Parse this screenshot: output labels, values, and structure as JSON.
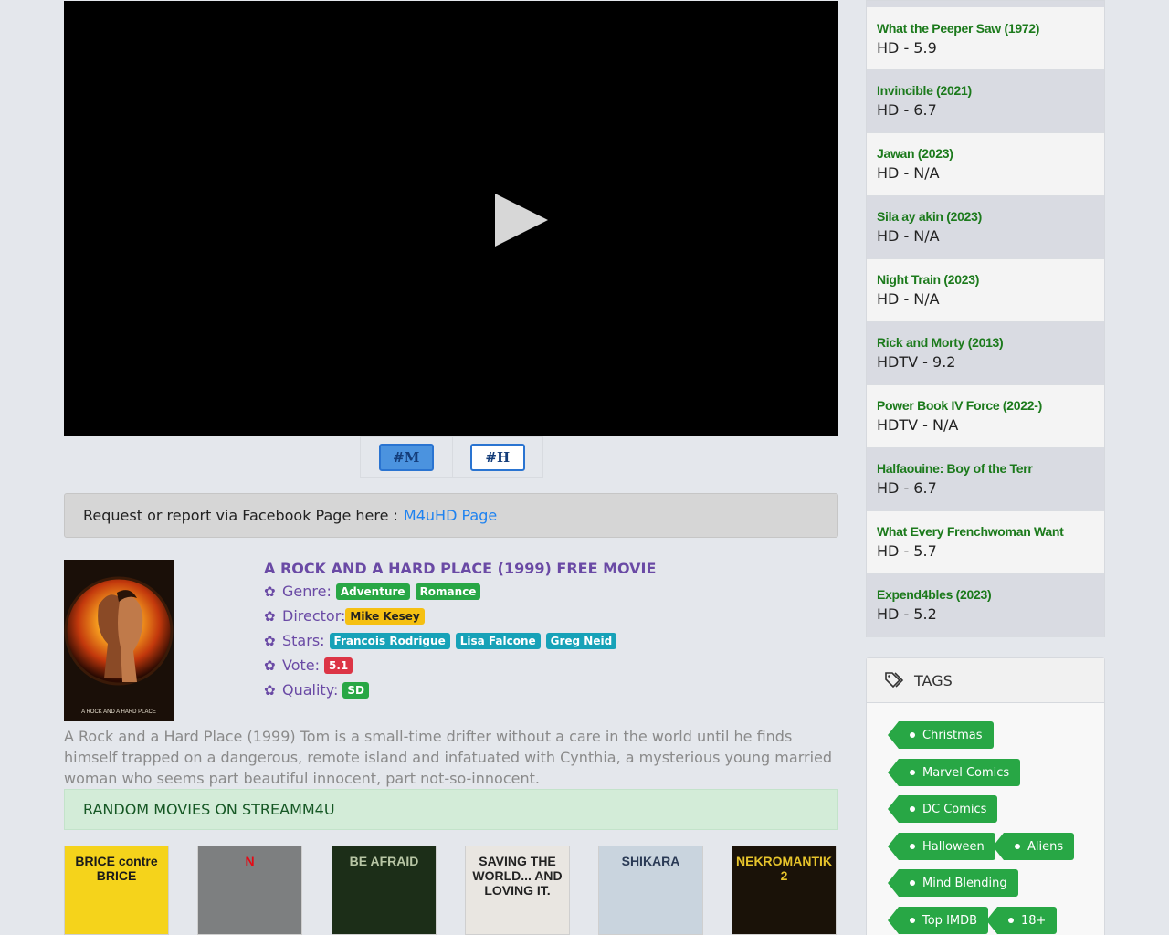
{
  "server": {
    "m_label": "#M",
    "h_label": "#H"
  },
  "report": {
    "text": "Request or report via Facebook Page here :",
    "link_label": "M4uHD Page"
  },
  "movie": {
    "title": "A ROCK AND A HARD PLACE (1999) FREE MOVIE",
    "genre_label": "Genre:",
    "genres": [
      "Adventure",
      "Romance"
    ],
    "director_label": "Director:",
    "director": "Mike Kesey",
    "stars_label": "Stars:",
    "stars": [
      "Francois Rodrigue",
      "Lisa Falcone",
      "Greg Neid"
    ],
    "vote_label": "Vote:",
    "vote": "5.1",
    "quality_label": "Quality:",
    "quality": "SD",
    "poster_caption": "A ROCK AND A HARD PLACE",
    "synopsis": "A Rock and a Hard Place (1999) Tom is a small-time drifter without a care in the world until he finds himself trapped on a dangerous, remote island and infatuated with Cynthia, a mysterious young married woman who seems part beautiful innocent, part not-so-innocent."
  },
  "random_section": {
    "title": "RANDOM MOVIES ON STREAMM4U",
    "posters": [
      {
        "text": "BRICE contre BRICE",
        "bg": "#f5d31b",
        "fg": "#1a1a1a"
      },
      {
        "text": "N",
        "bg": "#7d7f80",
        "fg": "#e50914"
      },
      {
        "text": "BE AFRAID",
        "bg": "#1c2e18",
        "fg": "#b8c6a5"
      },
      {
        "text": "SAVING THE WORLD... AND LOVING IT.",
        "bg": "#e9e6e1",
        "fg": "#222222"
      },
      {
        "text": "SHIKARA",
        "bg": "#c9d4de",
        "fg": "#2a3a55"
      },
      {
        "text": "NEKROMANTIK 2",
        "bg": "#1a1208",
        "fg": "#e7c42b"
      }
    ]
  },
  "sidebar": {
    "items": [
      {
        "title": "What the Peeper Saw (1972)",
        "meta": "HD - 5.9"
      },
      {
        "title": "Invincible (2021)",
        "meta": "HD - 6.7"
      },
      {
        "title": "Jawan (2023)",
        "meta": "HD - N/A"
      },
      {
        "title": "Sila ay akin (2023)",
        "meta": "HD - N/A"
      },
      {
        "title": "Night Train (2023)",
        "meta": "HD - N/A"
      },
      {
        "title": "Rick and Morty (2013)",
        "meta": "HDTV - 9.2"
      },
      {
        "title": "Power Book IV Force (2022-)",
        "meta": "HDTV - N/A"
      },
      {
        "title": "Halfaouine: Boy of the Terr",
        "meta": "HD - 6.7"
      },
      {
        "title": "What Every Frenchwoman Want",
        "meta": "HD - 5.7"
      },
      {
        "title": "Expend4bles (2023)",
        "meta": "HD - 5.2"
      }
    ]
  },
  "tags": {
    "title": "TAGS",
    "items": [
      "Christmas",
      "Marvel Comics",
      "DC Comics",
      "Halloween",
      "Aliens",
      "Mind Blending",
      "Top IMDB",
      "18+"
    ]
  },
  "colors": {
    "accent": "#6a4aa5",
    "tag_green": "#28a745",
    "link": "#1e82f0"
  }
}
